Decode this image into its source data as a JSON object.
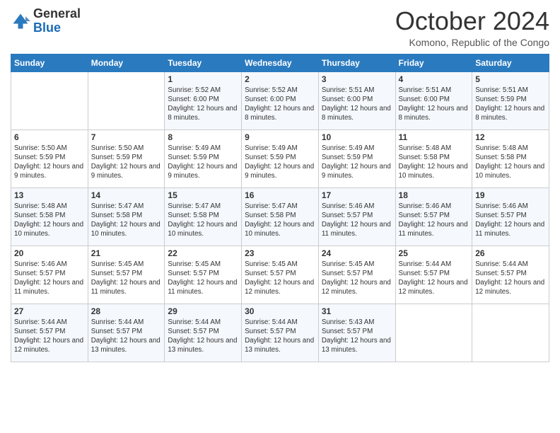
{
  "header": {
    "logo_line1": "General",
    "logo_line2": "Blue",
    "month": "October 2024",
    "location": "Komono, Republic of the Congo"
  },
  "days_of_week": [
    "Sunday",
    "Monday",
    "Tuesday",
    "Wednesday",
    "Thursday",
    "Friday",
    "Saturday"
  ],
  "weeks": [
    [
      {
        "day": "",
        "info": ""
      },
      {
        "day": "",
        "info": ""
      },
      {
        "day": "1",
        "info": "Sunrise: 5:52 AM\nSunset: 6:00 PM\nDaylight: 12 hours and 8 minutes."
      },
      {
        "day": "2",
        "info": "Sunrise: 5:52 AM\nSunset: 6:00 PM\nDaylight: 12 hours and 8 minutes."
      },
      {
        "day": "3",
        "info": "Sunrise: 5:51 AM\nSunset: 6:00 PM\nDaylight: 12 hours and 8 minutes."
      },
      {
        "day": "4",
        "info": "Sunrise: 5:51 AM\nSunset: 6:00 PM\nDaylight: 12 hours and 8 minutes."
      },
      {
        "day": "5",
        "info": "Sunrise: 5:51 AM\nSunset: 5:59 PM\nDaylight: 12 hours and 8 minutes."
      }
    ],
    [
      {
        "day": "6",
        "info": "Sunrise: 5:50 AM\nSunset: 5:59 PM\nDaylight: 12 hours and 9 minutes."
      },
      {
        "day": "7",
        "info": "Sunrise: 5:50 AM\nSunset: 5:59 PM\nDaylight: 12 hours and 9 minutes."
      },
      {
        "day": "8",
        "info": "Sunrise: 5:49 AM\nSunset: 5:59 PM\nDaylight: 12 hours and 9 minutes."
      },
      {
        "day": "9",
        "info": "Sunrise: 5:49 AM\nSunset: 5:59 PM\nDaylight: 12 hours and 9 minutes."
      },
      {
        "day": "10",
        "info": "Sunrise: 5:49 AM\nSunset: 5:59 PM\nDaylight: 12 hours and 9 minutes."
      },
      {
        "day": "11",
        "info": "Sunrise: 5:48 AM\nSunset: 5:58 PM\nDaylight: 12 hours and 10 minutes."
      },
      {
        "day": "12",
        "info": "Sunrise: 5:48 AM\nSunset: 5:58 PM\nDaylight: 12 hours and 10 minutes."
      }
    ],
    [
      {
        "day": "13",
        "info": "Sunrise: 5:48 AM\nSunset: 5:58 PM\nDaylight: 12 hours and 10 minutes."
      },
      {
        "day": "14",
        "info": "Sunrise: 5:47 AM\nSunset: 5:58 PM\nDaylight: 12 hours and 10 minutes."
      },
      {
        "day": "15",
        "info": "Sunrise: 5:47 AM\nSunset: 5:58 PM\nDaylight: 12 hours and 10 minutes."
      },
      {
        "day": "16",
        "info": "Sunrise: 5:47 AM\nSunset: 5:58 PM\nDaylight: 12 hours and 10 minutes."
      },
      {
        "day": "17",
        "info": "Sunrise: 5:46 AM\nSunset: 5:57 PM\nDaylight: 12 hours and 11 minutes."
      },
      {
        "day": "18",
        "info": "Sunrise: 5:46 AM\nSunset: 5:57 PM\nDaylight: 12 hours and 11 minutes."
      },
      {
        "day": "19",
        "info": "Sunrise: 5:46 AM\nSunset: 5:57 PM\nDaylight: 12 hours and 11 minutes."
      }
    ],
    [
      {
        "day": "20",
        "info": "Sunrise: 5:46 AM\nSunset: 5:57 PM\nDaylight: 12 hours and 11 minutes."
      },
      {
        "day": "21",
        "info": "Sunrise: 5:45 AM\nSunset: 5:57 PM\nDaylight: 12 hours and 11 minutes."
      },
      {
        "day": "22",
        "info": "Sunrise: 5:45 AM\nSunset: 5:57 PM\nDaylight: 12 hours and 11 minutes."
      },
      {
        "day": "23",
        "info": "Sunrise: 5:45 AM\nSunset: 5:57 PM\nDaylight: 12 hours and 12 minutes."
      },
      {
        "day": "24",
        "info": "Sunrise: 5:45 AM\nSunset: 5:57 PM\nDaylight: 12 hours and 12 minutes."
      },
      {
        "day": "25",
        "info": "Sunrise: 5:44 AM\nSunset: 5:57 PM\nDaylight: 12 hours and 12 minutes."
      },
      {
        "day": "26",
        "info": "Sunrise: 5:44 AM\nSunset: 5:57 PM\nDaylight: 12 hours and 12 minutes."
      }
    ],
    [
      {
        "day": "27",
        "info": "Sunrise: 5:44 AM\nSunset: 5:57 PM\nDaylight: 12 hours and 12 minutes."
      },
      {
        "day": "28",
        "info": "Sunrise: 5:44 AM\nSunset: 5:57 PM\nDaylight: 12 hours and 13 minutes."
      },
      {
        "day": "29",
        "info": "Sunrise: 5:44 AM\nSunset: 5:57 PM\nDaylight: 12 hours and 13 minutes."
      },
      {
        "day": "30",
        "info": "Sunrise: 5:44 AM\nSunset: 5:57 PM\nDaylight: 12 hours and 13 minutes."
      },
      {
        "day": "31",
        "info": "Sunrise: 5:43 AM\nSunset: 5:57 PM\nDaylight: 12 hours and 13 minutes."
      },
      {
        "day": "",
        "info": ""
      },
      {
        "day": "",
        "info": ""
      }
    ]
  ]
}
